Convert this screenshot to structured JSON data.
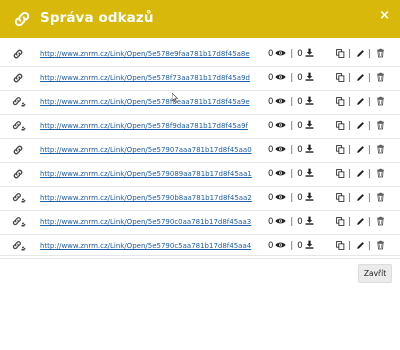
{
  "dialog": {
    "title": "Správa odkazů",
    "close_glyph": "×"
  },
  "rows": [
    {
      "icon": "link-icon",
      "url": "http://www.znrm.cz/Link/Open/5e578e9faa781b17d8f45a8e",
      "views": "0",
      "downloads": "0"
    },
    {
      "icon": "link-icon",
      "url": "http://www.znrm.cz/Link/Open/5e578f73aa781b17d8f45a9d",
      "views": "0",
      "downloads": "0"
    },
    {
      "icon": "link-users-icon",
      "url": "http://www.znrm.cz/Link/Open/5e578f8eaa781b17d8f45a9e",
      "views": "0",
      "downloads": "0"
    },
    {
      "icon": "link-users-icon",
      "url": "http://www.znrm.cz/Link/Open/5e578f9daa781b17d8f45a9f",
      "views": "0",
      "downloads": "0"
    },
    {
      "icon": "link-icon",
      "url": "http://www.znrm.cz/Link/Open/5e57907aaa781b17d8f45aa0",
      "views": "0",
      "downloads": "0"
    },
    {
      "icon": "link-icon",
      "url": "http://www.znrm.cz/Link/Open/5e579089aa781b17d8f45aa1",
      "views": "0",
      "downloads": "0"
    },
    {
      "icon": "link-users-icon",
      "url": "http://www.znrm.cz/Link/Open/5e5790b8aa781b17d8f45aa2",
      "views": "0",
      "downloads": "0"
    },
    {
      "icon": "link-users-icon",
      "url": "http://www.znrm.cz/Link/Open/5e5790c0aa781b17d8f45aa3",
      "views": "0",
      "downloads": "0"
    },
    {
      "icon": "link-users-icon",
      "url": "http://www.znrm.cz/Link/Open/5e5790c5aa781b17d8f45aa4",
      "views": "0",
      "downloads": "0"
    }
  ],
  "footer": {
    "close_label": "Zavřít"
  },
  "colors": {
    "header_bg": "#d8b80a",
    "link": "#1f5ea8"
  }
}
